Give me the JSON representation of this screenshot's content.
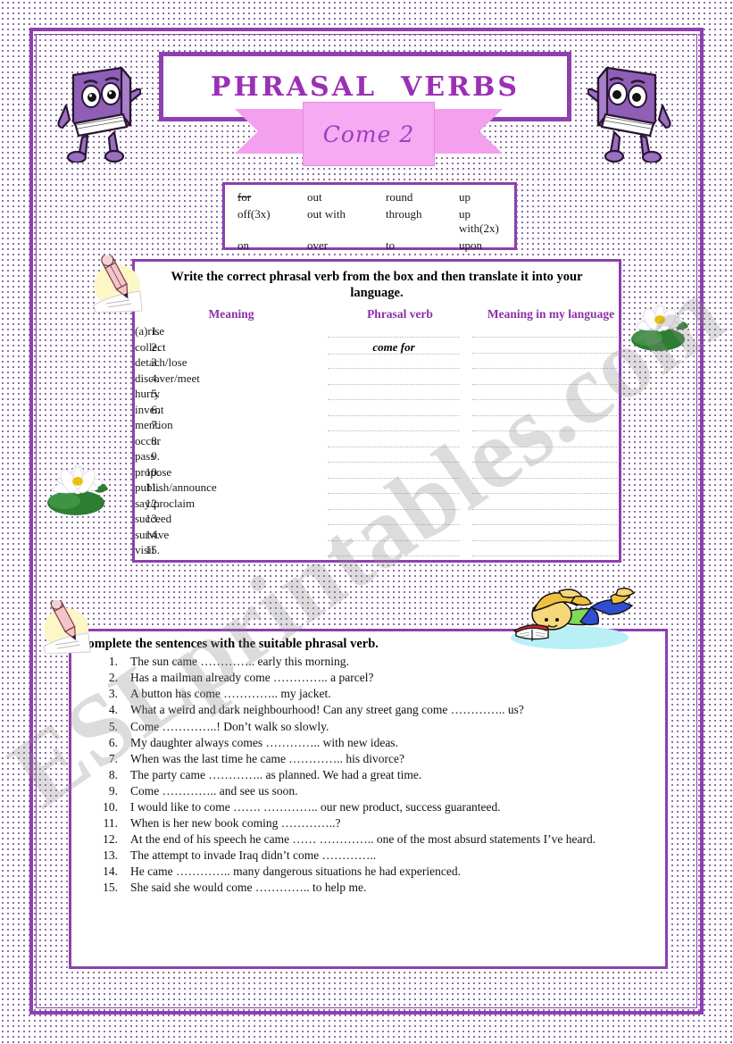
{
  "title": "PHRASAL  VERBS",
  "subtitle": "Come 2",
  "wordbank": {
    "name": "particle-word-bank",
    "items": [
      {
        "text": "for",
        "struck": true
      },
      {
        "text": "out",
        "struck": false
      },
      {
        "text": "round",
        "struck": false
      },
      {
        "text": "up",
        "struck": false
      },
      {
        "text": "off(3x)",
        "struck": false
      },
      {
        "text": "out with",
        "struck": false
      },
      {
        "text": "through",
        "struck": false
      },
      {
        "text": "up with(2x)",
        "struck": false
      },
      {
        "text": "on",
        "struck": false
      },
      {
        "text": "over",
        "struck": false
      },
      {
        "text": "to",
        "struck": false
      },
      {
        "text": "upon",
        "struck": false
      }
    ]
  },
  "exercise1": {
    "instruction": "Write the correct phrasal verb from the box and then translate it into your language.",
    "headers": {
      "meaning": "Meaning",
      "phrasal_verb": "Phrasal verb",
      "translation": "Meaning in my language"
    },
    "rows": [
      {
        "num": "1.",
        "meaning": "(a)rise",
        "answer": ""
      },
      {
        "num": "2.",
        "meaning": "collect",
        "answer": "come for"
      },
      {
        "num": "3.",
        "meaning": "detach/lose",
        "answer": ""
      },
      {
        "num": "4.",
        "meaning": "discover/meet",
        "answer": ""
      },
      {
        "num": "5.",
        "meaning": "hurry",
        "answer": ""
      },
      {
        "num": "6.",
        "meaning": "invent",
        "answer": ""
      },
      {
        "num": "7.",
        "meaning": "mention",
        "answer": ""
      },
      {
        "num": "8.",
        "meaning": "occur",
        "answer": ""
      },
      {
        "num": "9.",
        "meaning": "pass",
        "answer": ""
      },
      {
        "num": "10.",
        "meaning": "propose",
        "answer": ""
      },
      {
        "num": "11.",
        "meaning": "publish/announce",
        "answer": ""
      },
      {
        "num": "12.",
        "meaning": "say/proclaim",
        "answer": ""
      },
      {
        "num": "13.",
        "meaning": "succeed",
        "answer": ""
      },
      {
        "num": "14.",
        "meaning": "survive",
        "answer": ""
      },
      {
        "num": "15.",
        "meaning": "visit",
        "answer": ""
      }
    ]
  },
  "exercise2": {
    "instruction": "Complete the sentences with the suitable phrasal verb.",
    "sentences": [
      {
        "num": "1.",
        "text": "The sun came ………….. early this morning."
      },
      {
        "num": "2.",
        "text": "Has a mailman already come ………….. a parcel?"
      },
      {
        "num": "3.",
        "text": "A button has come ………….. my jacket."
      },
      {
        "num": "4.",
        "text": "What a weird and dark neighbourhood! Can any street gang come ………….. us?"
      },
      {
        "num": "5.",
        "text": "Come …………..! Don’t walk so slowly."
      },
      {
        "num": "6.",
        "text": "My daughter always comes ………….. with new ideas."
      },
      {
        "num": "7.",
        "text": "When was the last time he came ………….. his divorce?"
      },
      {
        "num": "8.",
        "text": "The party came ………….. as planned. We had a great time."
      },
      {
        "num": "9.",
        "text": "Come ………….. and see us soon."
      },
      {
        "num": "10.",
        "text": "I would like to come …….  ………….. our new product, success guaranteed."
      },
      {
        "num": "11.",
        "text": "When is her new book coming …………..?"
      },
      {
        "num": "12.",
        "text": "At the end of his speech he came ……  ………….. one of the most absurd statements I’ve heard."
      },
      {
        "num": "13.",
        "text": "The attempt to invade Iraq didn’t come ………….."
      },
      {
        "num": "14.",
        "text": "He came ………….. many dangerous situations he had experienced."
      },
      {
        "num": "15.",
        "text": "She said she would come ………….. to help me."
      }
    ]
  },
  "watermark": "ESLprintables.com",
  "colors": {
    "purple_border": "#8e3fb0",
    "title_purple": "#9b2fb5",
    "ribbon_pink": "#f5aaf2",
    "header_purple": "#8e2fa8",
    "dot_background": "#6b3f8f"
  }
}
